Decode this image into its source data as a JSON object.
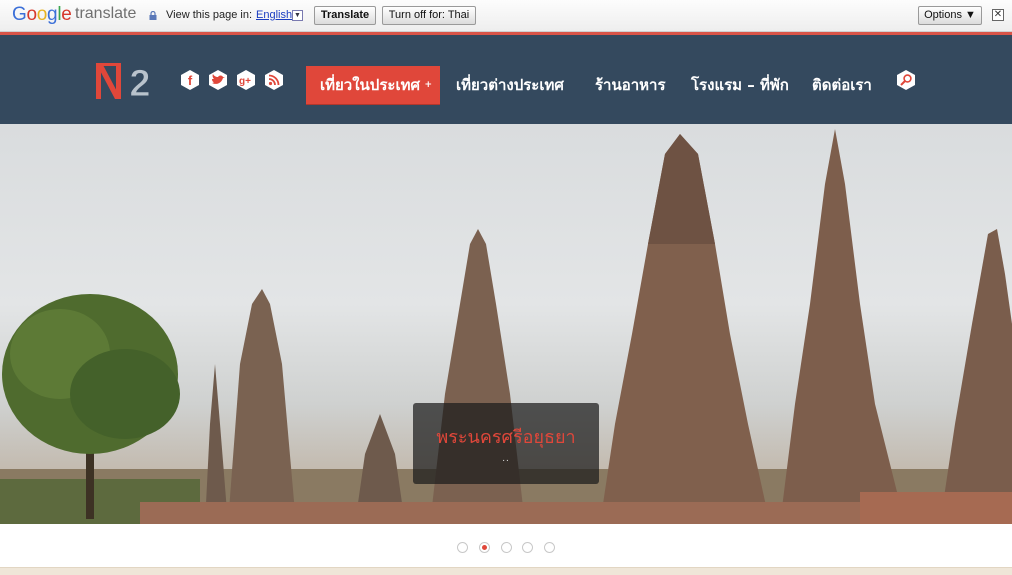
{
  "translate_bar": {
    "logo_google": [
      "G",
      "o",
      "o",
      "g",
      "l",
      "e"
    ],
    "logo_word": "translate",
    "view_text": "View this page in:",
    "language": "English",
    "translate_button": "Translate",
    "turn_off_button": "Turn off for: Thai",
    "options_button": "Options ▼"
  },
  "header": {
    "logo_icon": "ni2-logo-icon",
    "social_icons": [
      "facebook-icon",
      "twitter-icon",
      "googleplus-icon",
      "rss-icon"
    ],
    "nav": [
      {
        "label": "เที่ยวในประเทศ",
        "active": true
      },
      {
        "label": "เที่ยวต่างประเทศ",
        "active": false
      },
      {
        "label": "ร้านอาหาร",
        "active": false
      },
      {
        "label": "โรงแรม – ที่พัก",
        "active": false
      },
      {
        "label": "ติดต่อเรา",
        "active": false
      }
    ],
    "active_plus": "+",
    "search_icon": "search-icon"
  },
  "slider": {
    "caption_title": "พระนครศรีอยุธยา",
    "caption_sub": "..",
    "dots": [
      false,
      true,
      false,
      false,
      false
    ]
  },
  "colors": {
    "header_bg": "#34495e",
    "accent": "#e0473a"
  }
}
